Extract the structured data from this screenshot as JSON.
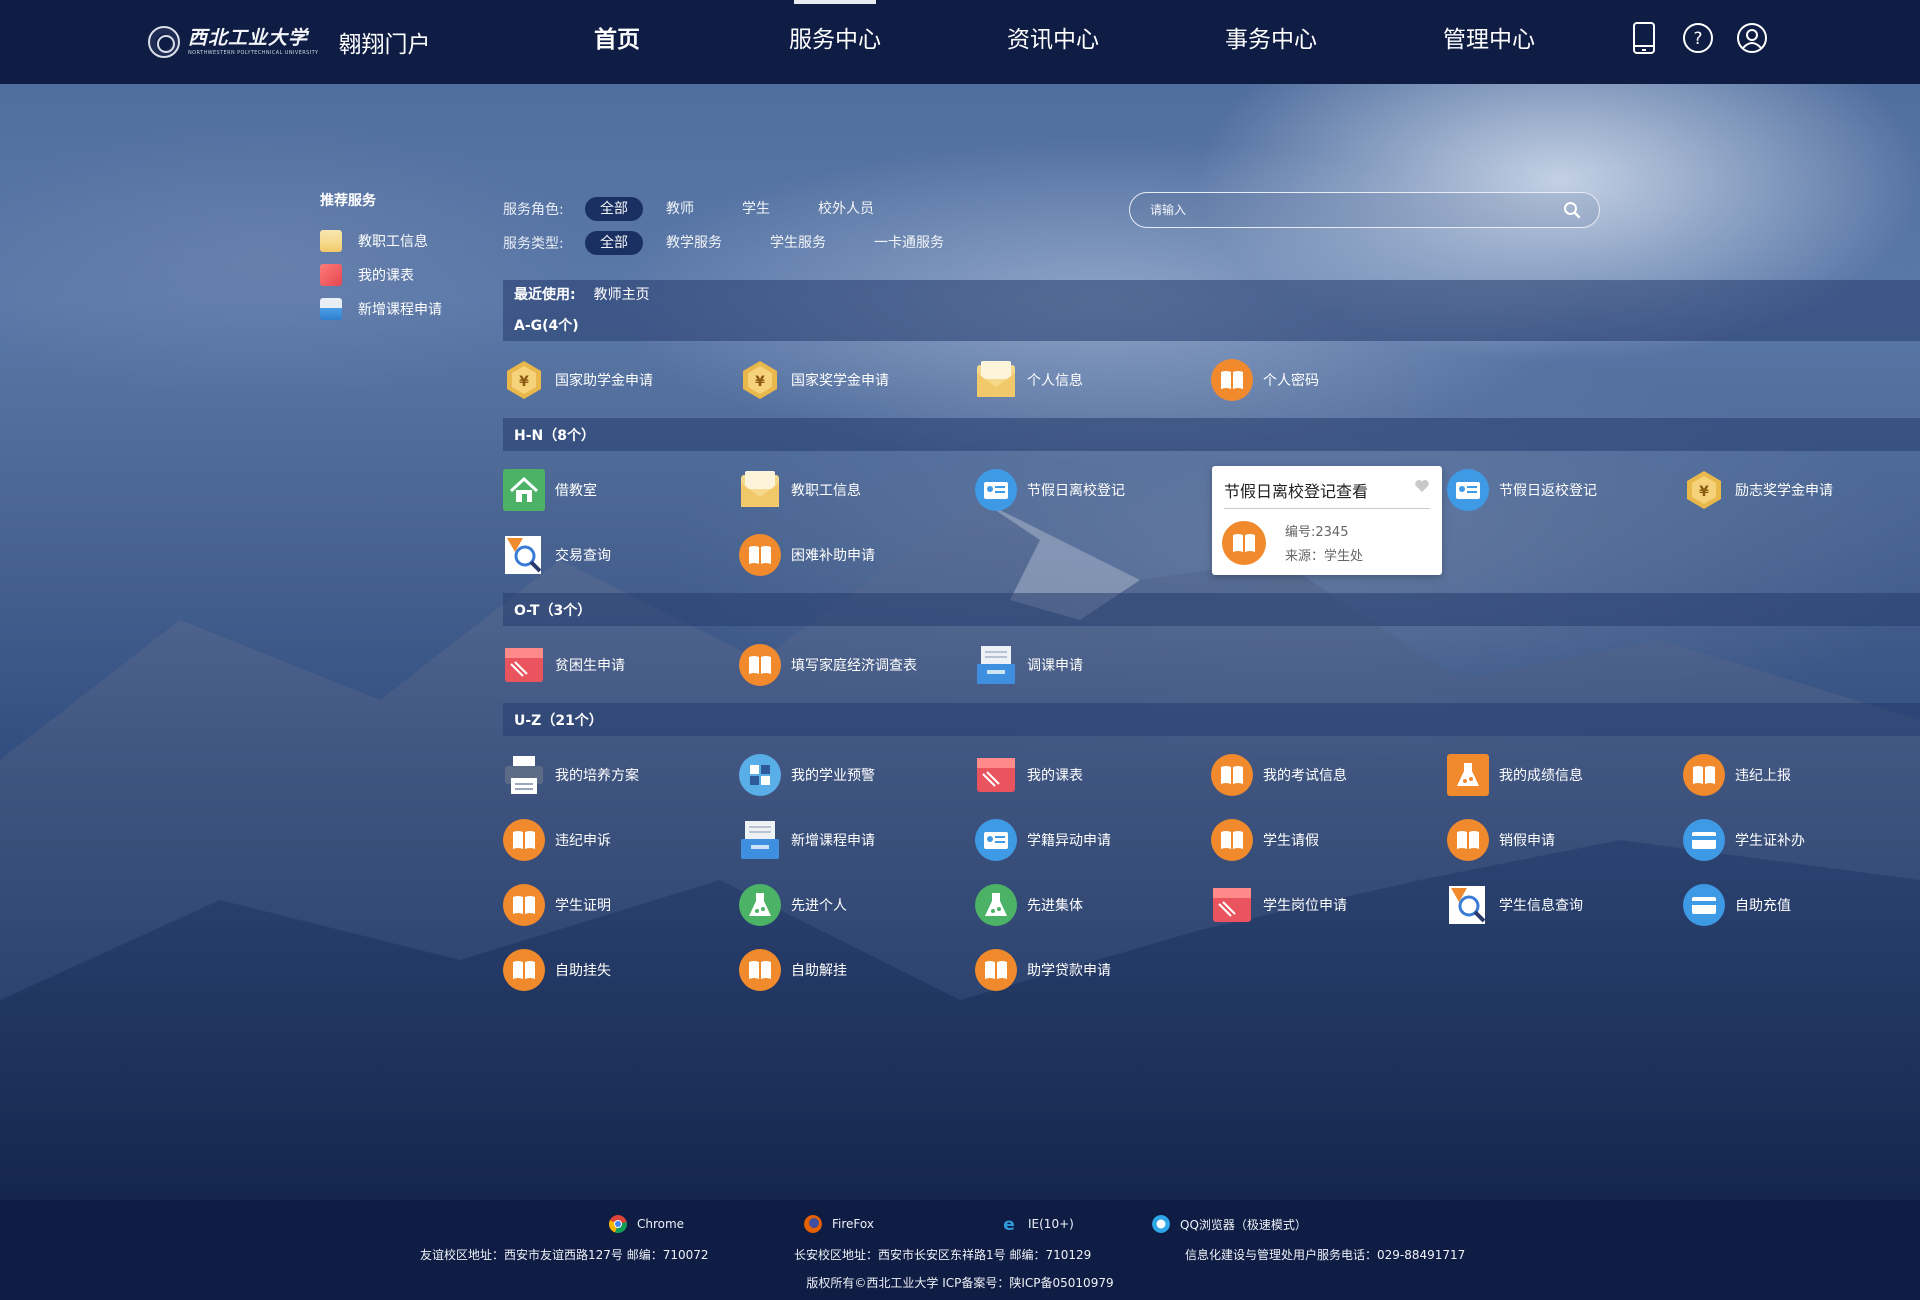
{
  "header": {
    "logo_cn": "西北工业大学",
    "logo_en": "NORTHWESTERN POLYTECHNICAL UNIVERSITY",
    "portal_name": "翱翔门户",
    "nav": [
      "首页",
      "服务中心",
      "资讯中心",
      "事务中心",
      "管理中心"
    ],
    "icons": [
      "tablet-icon",
      "help-icon",
      "user-icon"
    ]
  },
  "sidebar": {
    "title": "推荐服务",
    "items": [
      "教职工信息",
      "我的课表",
      "新增课程申请"
    ]
  },
  "filters": {
    "role_label": "服务角色:",
    "roles": [
      "全部",
      "教师",
      "学生",
      "校外人员"
    ],
    "type_label": "服务类型:",
    "types": [
      "全部",
      "教学服务",
      "学生服务",
      "一卡通服务"
    ]
  },
  "search": {
    "placeholder": "请输入"
  },
  "recent": {
    "label": "最近使用:",
    "item": "教师主页"
  },
  "groups": [
    {
      "title": "A-G(4个)",
      "items": [
        {
          "label": "国家助学金申请",
          "icon": "medal"
        },
        {
          "label": "国家奖学金申请",
          "icon": "medal"
        },
        {
          "label": "个人信息",
          "icon": "envelope"
        },
        {
          "label": "个人密码",
          "icon": "book"
        }
      ]
    },
    {
      "title": "H-N（8个）",
      "items": [
        {
          "label": "借教室",
          "icon": "house"
        },
        {
          "label": "教职工信息",
          "icon": "envelope"
        },
        {
          "label": "节假日离校登记",
          "icon": "idcard"
        },
        {
          "label": "",
          "icon": "none"
        },
        {
          "label": "节假日返校登记",
          "icon": "idcard"
        },
        {
          "label": "励志奖学金申请",
          "icon": "medal"
        },
        {
          "label": "交易查询",
          "icon": "magnifier"
        },
        {
          "label": "困难补助申请",
          "icon": "book"
        }
      ]
    },
    {
      "title": "O-T（3个）",
      "items": [
        {
          "label": "贫困生申请",
          "icon": "redcard"
        },
        {
          "label": "填写家庭经济调查表",
          "icon": "book"
        },
        {
          "label": "调课申请",
          "icon": "tray"
        }
      ]
    },
    {
      "title": "U-Z（21个）",
      "items": [
        {
          "label": "我的培养方案",
          "icon": "printer"
        },
        {
          "label": "我的学业预警",
          "icon": "blocks"
        },
        {
          "label": "我的课表",
          "icon": "redcard"
        },
        {
          "label": "我的考试信息",
          "icon": "book"
        },
        {
          "label": "我的成绩信息",
          "icon": "flask-orange"
        },
        {
          "label": "违纪上报",
          "icon": "book"
        },
        {
          "label": "违纪申诉",
          "icon": "book"
        },
        {
          "label": "新增课程申请",
          "icon": "tray"
        },
        {
          "label": "学籍异动申请",
          "icon": "idcard"
        },
        {
          "label": "学生请假",
          "icon": "book"
        },
        {
          "label": "销假申请",
          "icon": "book"
        },
        {
          "label": "学生证补办",
          "icon": "creditcard"
        },
        {
          "label": "学生证明",
          "icon": "book"
        },
        {
          "label": "先进个人",
          "icon": "flask-green"
        },
        {
          "label": "先进集体",
          "icon": "flask-green"
        },
        {
          "label": "学生岗位申请",
          "icon": "redcard"
        },
        {
          "label": "学生信息查询",
          "icon": "magnifier"
        },
        {
          "label": "自助充值",
          "icon": "creditcard"
        },
        {
          "label": "自助挂失",
          "icon": "book"
        },
        {
          "label": "自助解挂",
          "icon": "book"
        },
        {
          "label": "助学贷款申请",
          "icon": "book"
        }
      ]
    }
  ],
  "popup": {
    "title": "节假日离校登记查看",
    "code": "编号:2345",
    "source": "来源：学生处"
  },
  "footer": {
    "browsers": [
      "Chrome",
      "FireFox",
      "IE(10+)",
      "QQ浏览器（极速模式）"
    ],
    "addr1": "友谊校区地址：西安市友谊西路127号    邮编：710072",
    "addr2": "长安校区地址：西安市长安区东祥路1号    邮编：710129",
    "addr3": "信息化建设与管理处用户服务电话：029-88491717",
    "copyright": "版权所有©西北工业大学    ICP备案号：陕ICP备05010979"
  },
  "colors": {
    "header_bg": "#0f1d44",
    "accent_orange": "#f08a2c",
    "band": "#263c6e"
  }
}
